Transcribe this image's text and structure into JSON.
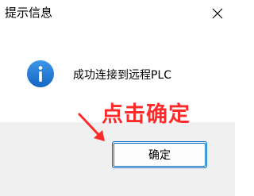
{
  "dialog": {
    "title": "提示信息",
    "message": "成功连接到远程PLC",
    "ok_label": "确定",
    "icon": "info-icon",
    "close_icon": "close-icon"
  },
  "annotation": {
    "text": "点击确定",
    "color": "#ff2a2a"
  },
  "colors": {
    "accent": "#0067c0",
    "info_icon": "#1f7fd8",
    "footer_bg": "#f0f0f0"
  }
}
